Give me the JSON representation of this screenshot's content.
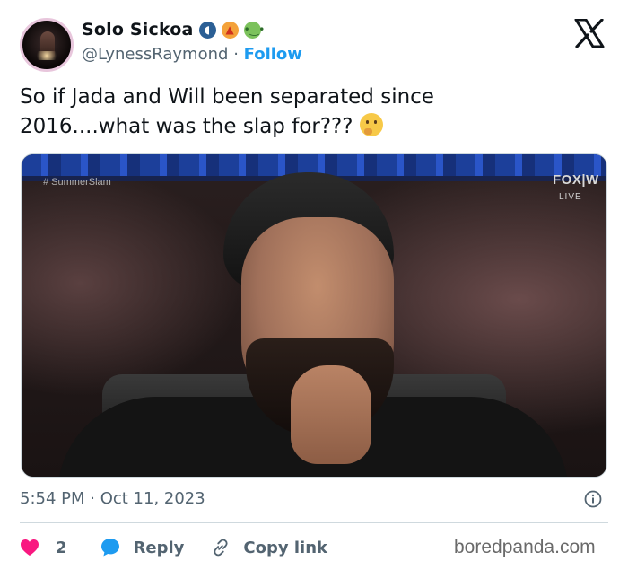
{
  "author": {
    "display_name": "Solo Sickoa",
    "emojis": [
      "speaking-head-emoji",
      "fire-emoji",
      "nauseated-face-emoji"
    ],
    "handle": "@LynessRaymond",
    "separator": "·",
    "follow_label": "Follow"
  },
  "tweet": {
    "text_line1": "So if Jada and Will been separated since",
    "text_line2": "2016....what was the slap for???",
    "trailing_emoji": "thinking-face-emoji"
  },
  "media": {
    "hashtag": "# SummerSlam",
    "network_logo": "FOX|W",
    "live_label": "LIVE"
  },
  "meta": {
    "timestamp": "5:54 PM · Oct 11, 2023",
    "info_icon": "info-icon"
  },
  "actions": {
    "like_count": "2",
    "reply_label": "Reply",
    "copy_link_label": "Copy link"
  },
  "watermark": "boredpanda.com",
  "colors": {
    "accent": "#1d9bf0",
    "heart": "#f91880",
    "muted": "#536471",
    "text": "#0f1419"
  }
}
